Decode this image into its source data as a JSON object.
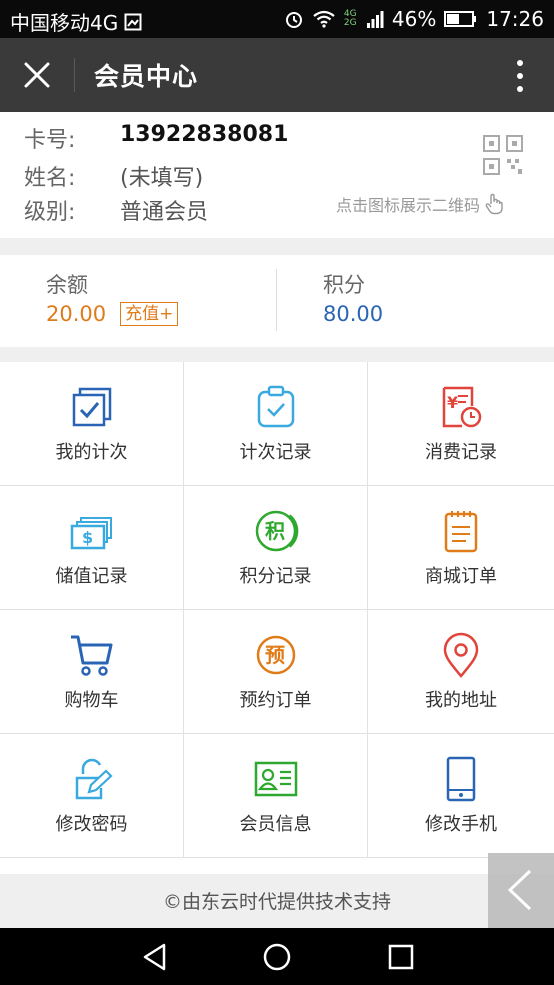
{
  "status_bar": {
    "carrier": "中国移动4G",
    "network": "4G 2G",
    "battery": "46%",
    "time": "17:26"
  },
  "header": {
    "title": "会员中心"
  },
  "member": {
    "card_label": "卡号:",
    "card_value": "13922838081",
    "name_label": "姓名:",
    "name_value": "(未填写)",
    "level_label": "级别:",
    "level_value": "普通会员",
    "qr_hint": "点击图标展示二维码"
  },
  "balance": {
    "balance_label": "余额",
    "balance_value": "20.00",
    "recharge_label": "充值+",
    "points_label": "积分",
    "points_value": "80.00"
  },
  "grid": {
    "items": [
      {
        "label": "我的计次",
        "icon": "checkbox-stack-icon"
      },
      {
        "label": "计次记录",
        "icon": "clipboard-check-icon"
      },
      {
        "label": "消费记录",
        "icon": "receipt-clock-icon"
      },
      {
        "label": "储值记录",
        "icon": "cash-stack-icon"
      },
      {
        "label": "积分记录",
        "icon": "points-circle-icon"
      },
      {
        "label": "商城订单",
        "icon": "notepad-icon"
      },
      {
        "label": "购物车",
        "icon": "cart-icon"
      },
      {
        "label": "预约订单",
        "icon": "appointment-circle-icon"
      },
      {
        "label": "我的地址",
        "icon": "location-pin-icon"
      },
      {
        "label": "修改密码",
        "icon": "lock-edit-icon"
      },
      {
        "label": "会员信息",
        "icon": "id-card-icon"
      },
      {
        "label": "修改手机",
        "icon": "phone-icon"
      }
    ]
  },
  "footer": {
    "text": "©由东云时代提供技术支持"
  },
  "colors": {
    "blue": "#2a64b4",
    "cyan": "#39a9e0",
    "red": "#e0443a",
    "green": "#2fa82f",
    "orange": "#e07b1a"
  }
}
